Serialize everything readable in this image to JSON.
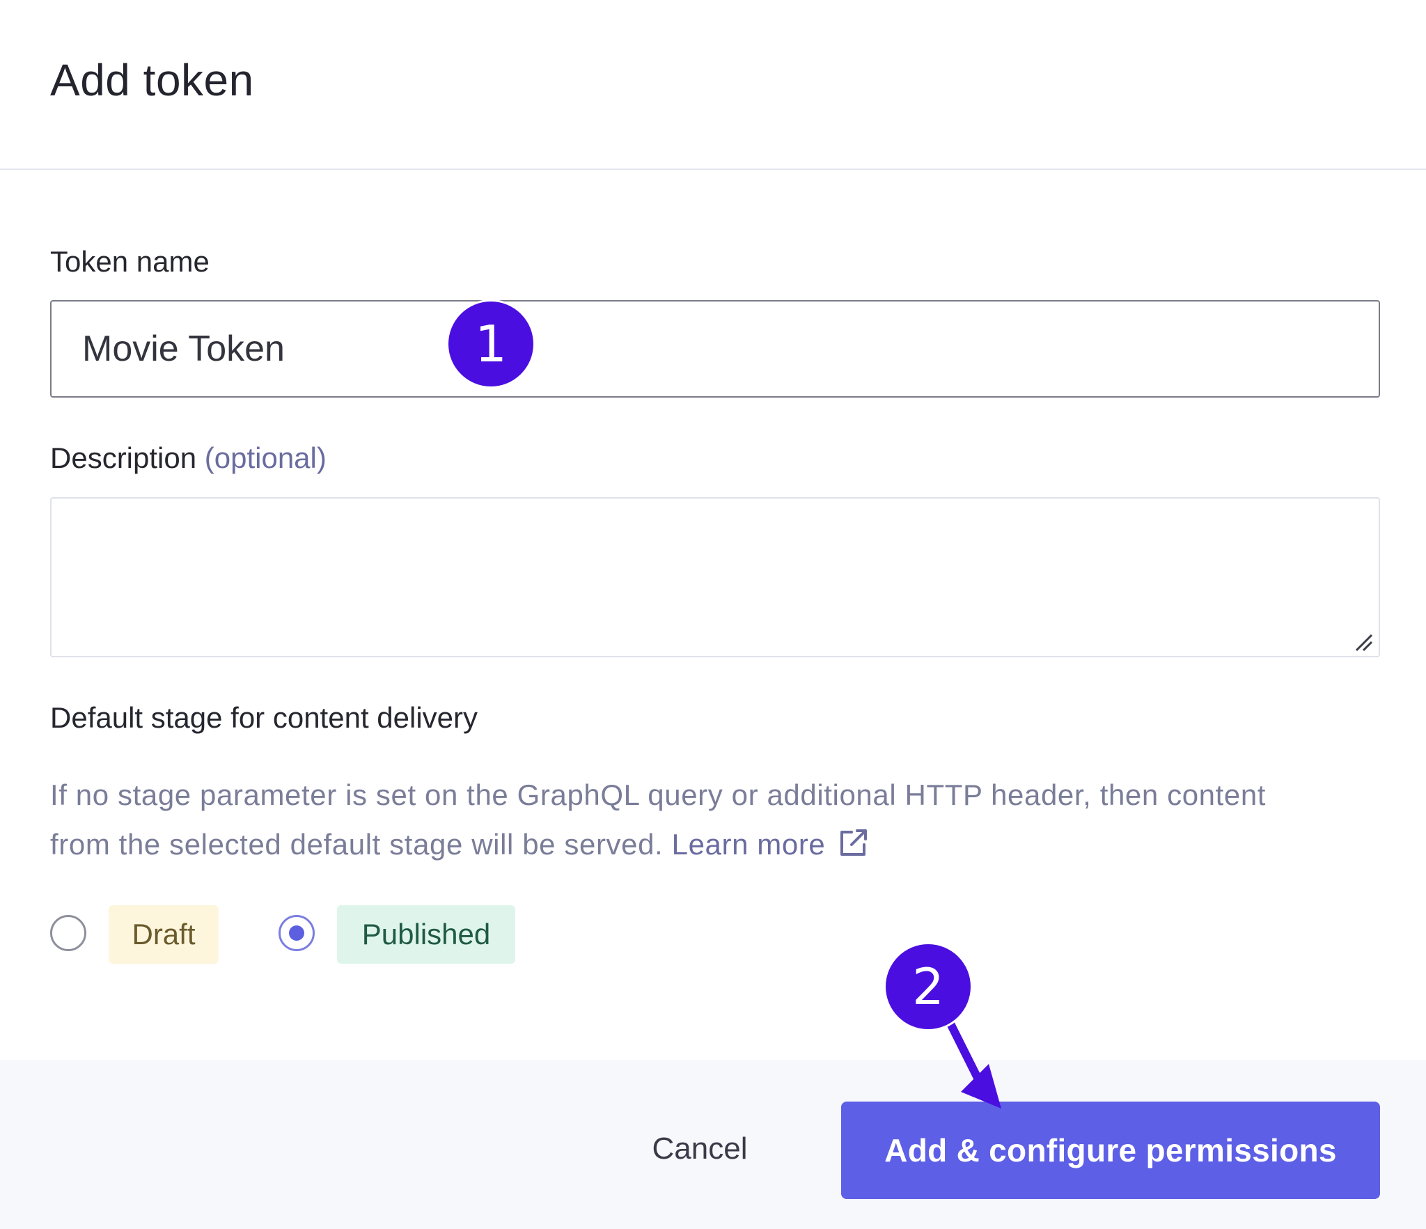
{
  "dialog": {
    "title": "Add token"
  },
  "token_name": {
    "label": "Token name",
    "value": "Movie Token"
  },
  "description": {
    "label": "Description",
    "optional_hint": "(optional)",
    "value": ""
  },
  "stage": {
    "label": "Default stage for content delivery",
    "help_text": "If no stage parameter is set on the GraphQL query or additional HTTP header, then content from the selected default stage will be served.",
    "learn_more": "Learn more",
    "options": [
      {
        "label": "Draft",
        "selected": false
      },
      {
        "label": "Published",
        "selected": true
      }
    ]
  },
  "footer": {
    "cancel_label": "Cancel",
    "primary_label": "Add & configure permissions"
  },
  "annotations": {
    "step1": "1",
    "step2": "2"
  },
  "colors": {
    "primary": "#5d5fe6",
    "annotation": "#4a0ee0",
    "draft_chip": "#fdf6dc",
    "published_chip": "#dff5ec"
  },
  "icons": {
    "external_link": "external-link-icon",
    "resize": "resize-handle-icon"
  }
}
